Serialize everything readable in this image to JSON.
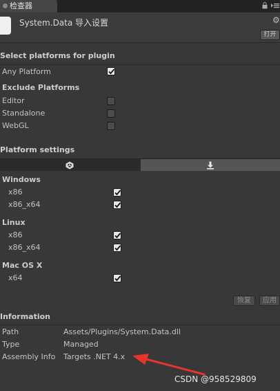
{
  "window": {
    "tab_label": "检查器",
    "header_title": "System.Data 导入设置",
    "open_button": "打开"
  },
  "plugin_platforms": {
    "title": "Select platforms for plugin",
    "any_platform": {
      "label": "Any Platform",
      "checked": true
    },
    "exclude_title": "Exclude Platforms",
    "exclude": [
      {
        "label": "Editor",
        "checked": false
      },
      {
        "label": "Standalone",
        "checked": false
      },
      {
        "label": "WebGL",
        "checked": false
      }
    ]
  },
  "platform_settings": {
    "title": "Platform settings",
    "tabs": [
      {
        "icon": "unity-icon",
        "active": false
      },
      {
        "icon": "download-icon",
        "active": true
      }
    ],
    "groups": [
      {
        "title": "Windows",
        "items": [
          {
            "label": "x86",
            "checked": true
          },
          {
            "label": "x86_x64",
            "checked": true
          }
        ]
      },
      {
        "title": "Linux",
        "items": [
          {
            "label": "x86",
            "checked": true
          },
          {
            "label": "x86_x64",
            "checked": true
          }
        ]
      },
      {
        "title": "Mac OS X",
        "items": [
          {
            "label": "x64",
            "checked": true
          }
        ]
      }
    ]
  },
  "actions": {
    "revert": "恢复",
    "apply": "应用"
  },
  "information": {
    "title": "Information",
    "rows": [
      {
        "label": "Path",
        "value": "Assets/Plugins/System.Data.dll"
      },
      {
        "label": "Type",
        "value": "Managed"
      },
      {
        "label": "Assembly Info",
        "value": "Targets .NET 4.x"
      }
    ]
  },
  "watermark": "CSDN @958529809",
  "colors": {
    "background": "#383838",
    "annotation_arrow": "#e8342a"
  }
}
